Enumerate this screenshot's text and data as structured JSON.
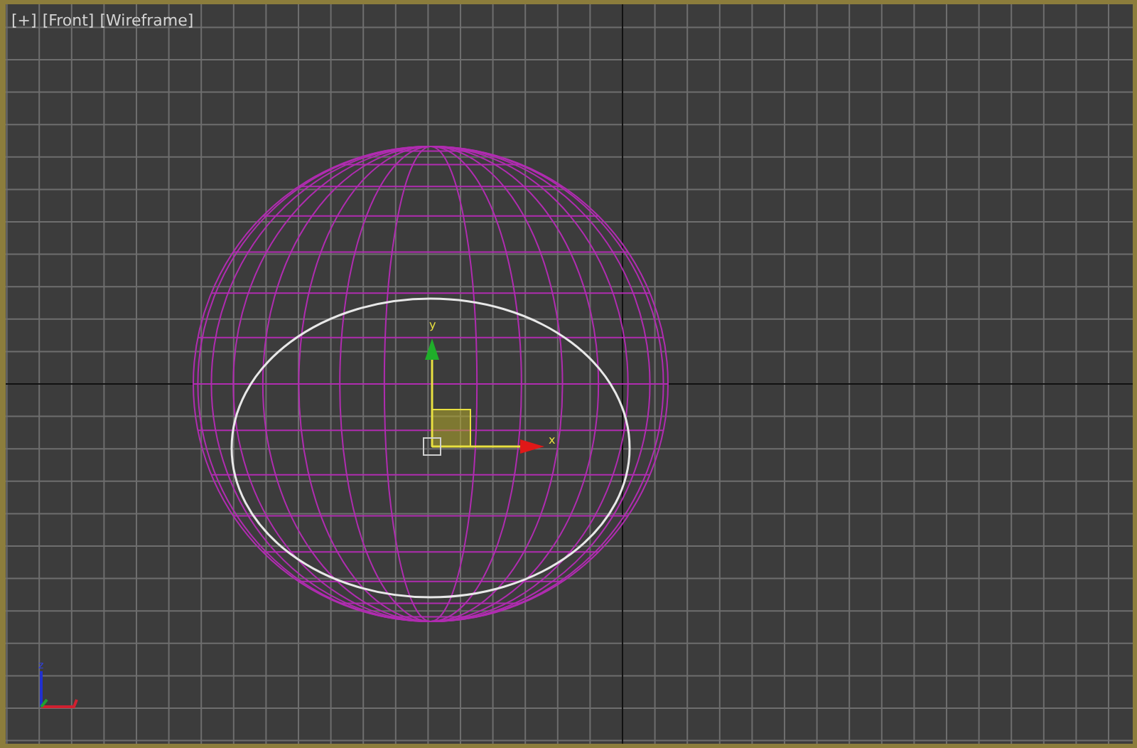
{
  "viewport": {
    "labels": [
      "[+]",
      "[Front]",
      "[Wireframe]"
    ]
  },
  "gizmo": {
    "y_label": "y",
    "x_label": "x"
  },
  "axis_tripod": {
    "z_label": "z"
  }
}
